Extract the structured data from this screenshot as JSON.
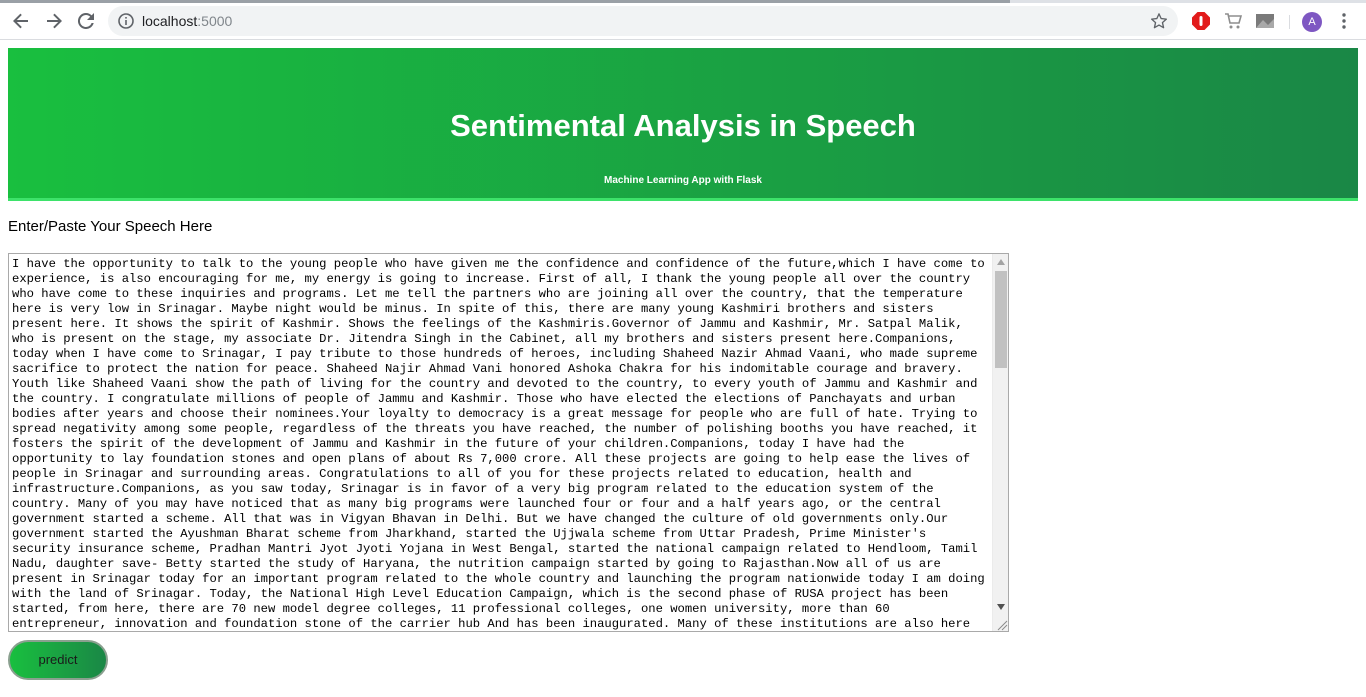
{
  "browser": {
    "url_host": "localhost",
    "url_port": ":5000",
    "profile_initial": "A",
    "icons": {
      "back": "back-arrow-icon",
      "forward": "forward-arrow-icon",
      "reload": "reload-icon",
      "site_info": "info-icon",
      "bookmark": "star-icon",
      "ext1": "adblock-icon",
      "ext2": "cart-icon",
      "ext3": "image-icon",
      "menu": "kebab-menu-icon"
    }
  },
  "header": {
    "title": "Sentimental Analysis in Speech",
    "subtitle": "Machine Learning App with Flask",
    "gradient_start": "#19bf3f",
    "gradient_end": "#1a8746",
    "border_color": "#3de26a"
  },
  "form": {
    "label": "Enter/Paste Your Speech Here",
    "speech_text": "I have the opportunity to talk to the young people who have given me the confidence and confidence of the future,which I have come to experience, is also encouraging for me, my energy is going to increase. First of all, I thank the young people all over the country who have come to these inquiries and programs. Let me tell the partners who are joining all over the country, that the temperature here is very low in Srinagar. Maybe night would be minus. In spite of this, there are many young Kashmiri brothers and sisters present here. It shows the spirit of Kashmir. Shows the feelings of the Kashmiris.Governor of Jammu and Kashmir, Mr. Satpal Malik, who is present on the stage, my associate Dr. Jitendra Singh in the Cabinet, all my brothers and sisters present here.Companions, today when I have come to Srinagar, I pay tribute to those hundreds of heroes, including Shaheed Nazir Ahmad Vaani, who made supreme sacrifice to protect the nation for peace. Shaheed Najir Ahmad Vani honored Ashoka Chakra for his indomitable courage and bravery. Youth like Shaheed Vaani show the path of living for the country and devoted to the country, to every youth of Jammu and Kashmir and the country. I congratulate millions of people of Jammu and Kashmir. Those who have elected the elections of Panchayats and urban bodies after years and choose their nominees.Your loyalty to democracy is a great message for people who are full of hate. Trying to spread negativity among some people, regardless of the threats you have reached, the number of polishing booths you have reached, it fosters the spirit of the development of Jammu and Kashmir in the future of your children.Companions, today I have had the opportunity to lay foundation stones and open plans of about Rs 7,000 crore. All these projects are going to help ease the lives of people in Srinagar and surrounding areas. Congratulations to all of you for these projects related to education, health and infrastructure.Companions, as you saw today, Srinagar is in favor of a very big program related to the education system of the country. Many of you may have noticed that as many big programs were launched four or four and a half years ago, or the central government started a scheme. All that was in Vigyan Bhavan in Delhi. But we have changed the culture of old governments only.Our government started the Ayushman Bharat scheme from Jharkhand, started the Ujjwala scheme from Uttar Pradesh, Prime Minister's security insurance scheme, Pradhan Mantri Jyot Jyoti Yojana in West Bengal, started the national campaign related to Hendloom, Tamil Nadu, daughter save- Betty started the study of Haryana, the nutrition campaign started by going to Rajasthan.Now all of us are present in Srinagar today for an important program related to the whole country and launching the program nationwide today I am doing with the land of Srinagar. Today, the National High Level Education Campaign, which is the second phase of RUSA project has been started, from here, there are 70 new model degree colleges, 11 professional colleges, one women university, more than 60 entrepreneur, innovation and foundation stone of the carrier hub And has been inaugurated. Many of these institutions are also here",
    "predict_label": "predict"
  }
}
